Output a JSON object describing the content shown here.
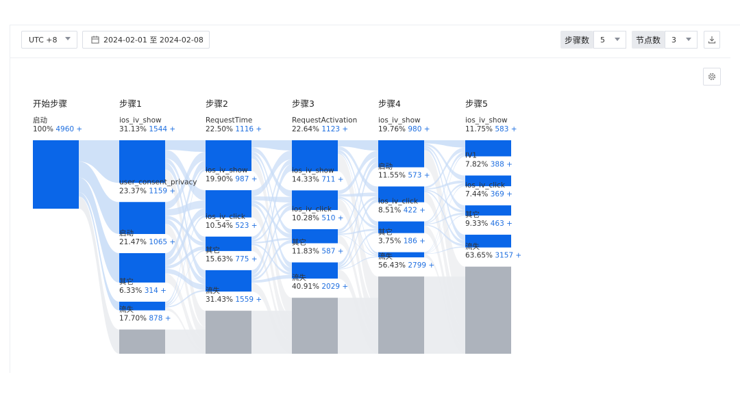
{
  "toolbar": {
    "timezone": "UTC +8",
    "date_range": "2024-02-01 至 2024-02-08",
    "steps_label": "步骤数",
    "steps_value": "5",
    "nodes_label": "节点数",
    "nodes_value": "3"
  },
  "icons": {
    "calendar": "calendar-icon",
    "download": "download-icon",
    "settings": "settings-icon",
    "caret": "chevron-down-icon"
  },
  "colors": {
    "node": "#0a66e8",
    "lost": "#adb3bc",
    "link": "#c7dcf7",
    "lost_link": "#e9ebee",
    "value": "#1f6fe0"
  },
  "chart_data": {
    "type": "sankey",
    "total": 4960,
    "columns": [
      {
        "title": "开始步骤",
        "nodes": [
          {
            "name": "启动",
            "pct": "100%",
            "value": 4960
          }
        ]
      },
      {
        "title": "步骤1",
        "nodes": [
          {
            "name": "ios_iv_show",
            "pct": "31.13%",
            "value": 1544
          },
          {
            "name": "user_consent_privacy",
            "pct": "23.37%",
            "value": 1159
          },
          {
            "name": "启动",
            "pct": "21.47%",
            "value": 1065
          },
          {
            "name": "其它",
            "pct": "6.33%",
            "value": 314
          },
          {
            "name": "流失",
            "pct": "17.70%",
            "value": 878,
            "lost": true
          }
        ]
      },
      {
        "title": "步骤2",
        "nodes": [
          {
            "name": "RequestTime",
            "pct": "22.50%",
            "value": 1116
          },
          {
            "name": "ios_iv_show",
            "pct": "19.90%",
            "value": 987
          },
          {
            "name": "ios_iv_click",
            "pct": "10.54%",
            "value": 523
          },
          {
            "name": "其它",
            "pct": "15.63%",
            "value": 775
          },
          {
            "name": "流失",
            "pct": "31.43%",
            "value": 1559,
            "lost": true
          }
        ]
      },
      {
        "title": "步骤3",
        "nodes": [
          {
            "name": "RequestActivation",
            "pct": "22.64%",
            "value": 1123
          },
          {
            "name": "ios_iv_show",
            "pct": "14.33%",
            "value": 711
          },
          {
            "name": "ios_iv_click",
            "pct": "10.28%",
            "value": 510
          },
          {
            "name": "其它",
            "pct": "11.83%",
            "value": 587
          },
          {
            "name": "流失",
            "pct": "40.91%",
            "value": 2029,
            "lost": true
          }
        ]
      },
      {
        "title": "步骤4",
        "nodes": [
          {
            "name": "ios_iv_show",
            "pct": "19.76%",
            "value": 980
          },
          {
            "name": "启动",
            "pct": "11.55%",
            "value": 573
          },
          {
            "name": "ios_iv_click",
            "pct": "8.51%",
            "value": 422
          },
          {
            "name": "其它",
            "pct": "3.75%",
            "value": 186
          },
          {
            "name": "流失",
            "pct": "56.43%",
            "value": 2799,
            "lost": true
          }
        ]
      },
      {
        "title": "步骤5",
        "nodes": [
          {
            "name": "ios_iv_show",
            "pct": "11.75%",
            "value": 583
          },
          {
            "name": "IV1",
            "pct": "7.82%",
            "value": 388
          },
          {
            "name": "ios_iv_click",
            "pct": "7.44%",
            "value": 369
          },
          {
            "name": "其它",
            "pct": "9.33%",
            "value": 463
          },
          {
            "name": "流失",
            "pct": "63.65%",
            "value": 3157,
            "lost": true
          }
        ]
      }
    ]
  }
}
